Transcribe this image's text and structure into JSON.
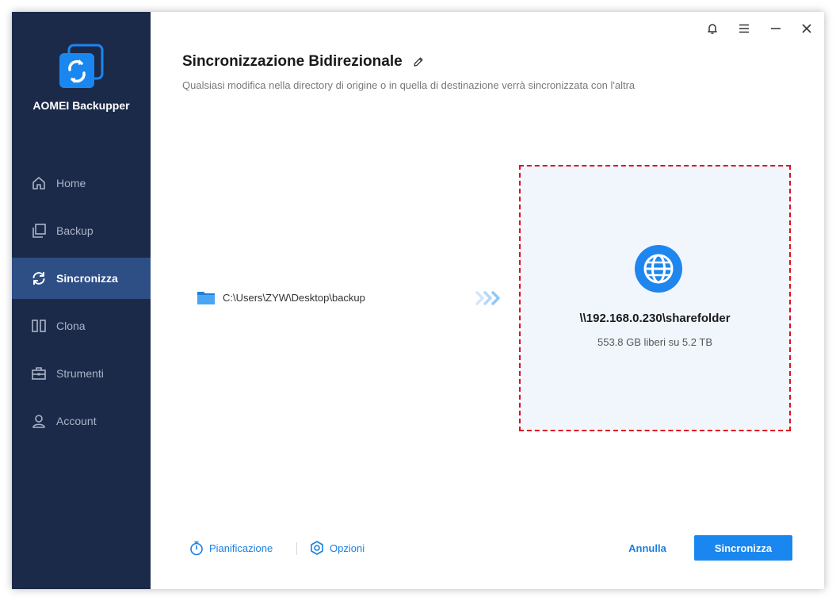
{
  "app": {
    "brand_name": "AOMEI Backupper",
    "logo_icon": "sync-logo-icon",
    "brand_color": "#1a87f0",
    "sidebar_bg": "#1c2a4a",
    "sidebar_active_bg": "#2e4e86"
  },
  "window_controls": {
    "items": [
      {
        "name": "notification",
        "icon": "bell-icon"
      },
      {
        "name": "menu",
        "icon": "hamburger-menu-icon"
      },
      {
        "name": "minimize",
        "icon": "minimize-icon"
      },
      {
        "name": "close",
        "icon": "close-icon"
      }
    ]
  },
  "sidebar": {
    "items": [
      {
        "label": "Home",
        "icon": "home-icon",
        "active": false
      },
      {
        "label": "Backup",
        "icon": "backup-icon",
        "active": false
      },
      {
        "label": "Sincronizza",
        "icon": "sync-icon",
        "active": true
      },
      {
        "label": "Clona",
        "icon": "clone-icon",
        "active": false
      },
      {
        "label": "Strumenti",
        "icon": "toolbox-icon",
        "active": false
      },
      {
        "label": "Account",
        "icon": "user-icon",
        "active": false
      }
    ]
  },
  "header": {
    "title": "Sincronizzazione Bidirezionale",
    "edit_icon": "pencil-icon",
    "subtitle": "Qualsiasi modifica nella directory di origine o in quella di destinazione verrà sincronizzata con l'altra"
  },
  "source": {
    "icon": "folder-icon",
    "path": "C:\\Users\\ZYW\\Desktop\\backup"
  },
  "transfer_arrows_icon": "double-chevron-right-icon",
  "destination": {
    "icon": "globe-icon",
    "path": "\\\\192.168.0.230\\sharefolder",
    "free_space": "553.8 GB liberi su 5.2 TB",
    "highlight_color": "#e0101e"
  },
  "footer": {
    "schedule_label": "Pianificazione",
    "schedule_icon": "stopwatch-icon",
    "options_label": "Opzioni",
    "options_icon": "settings-hex-icon",
    "cancel_label": "Annulla",
    "primary_label": "Sincronizza"
  }
}
